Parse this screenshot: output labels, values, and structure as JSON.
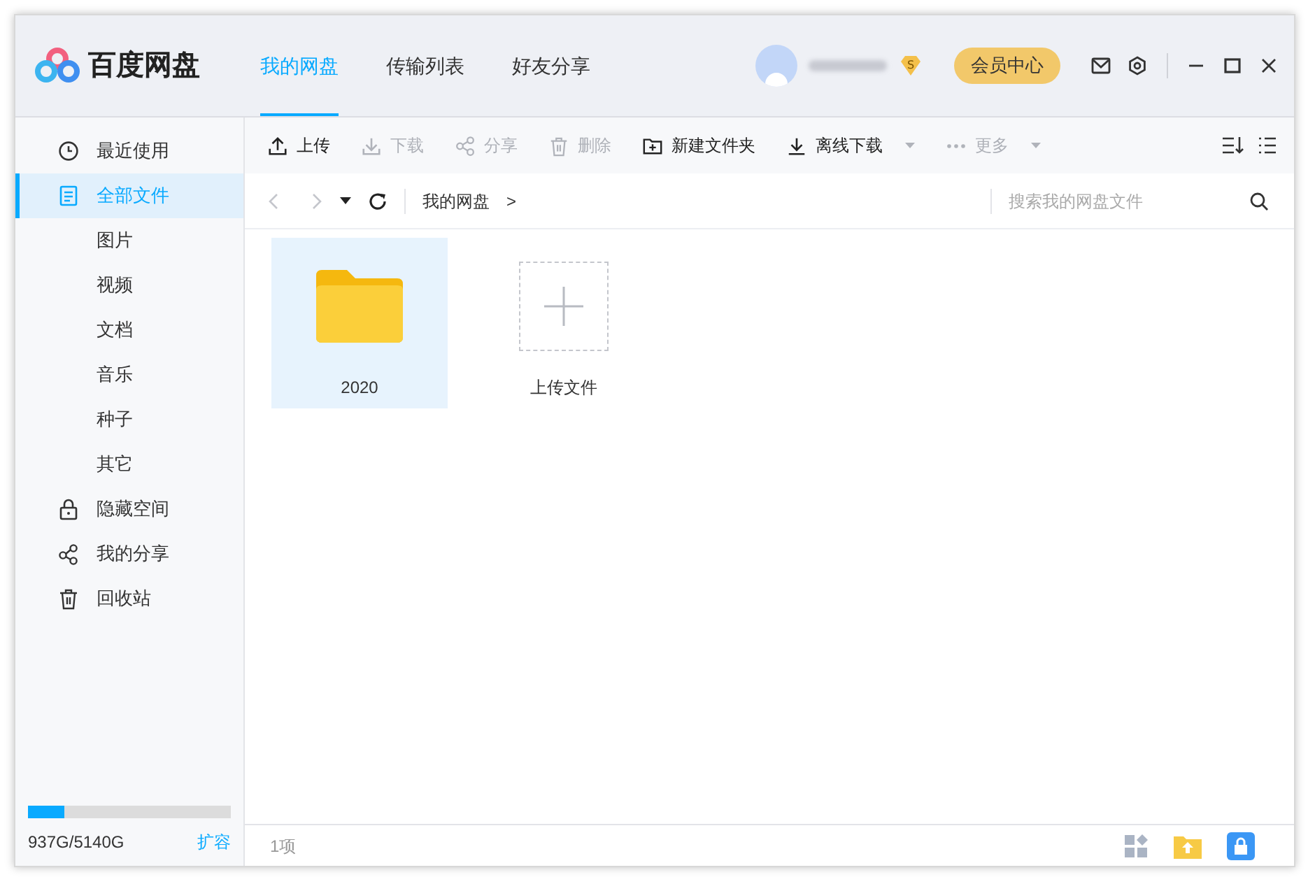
{
  "app": {
    "name": "百度网盘"
  },
  "tabs": [
    {
      "label": "我的网盘",
      "selected": true
    },
    {
      "label": "传输列表",
      "selected": false
    },
    {
      "label": "好友分享",
      "selected": false
    }
  ],
  "account": {
    "vip_badge": "S",
    "vip_button": "会员中心"
  },
  "sidebar": {
    "items": [
      {
        "label": "最近使用",
        "kind": "main",
        "selected": false
      },
      {
        "label": "全部文件",
        "kind": "main",
        "selected": true
      },
      {
        "label": "图片",
        "kind": "sub",
        "selected": false
      },
      {
        "label": "视频",
        "kind": "sub",
        "selected": false
      },
      {
        "label": "文档",
        "kind": "sub",
        "selected": false
      },
      {
        "label": "音乐",
        "kind": "sub",
        "selected": false
      },
      {
        "label": "种子",
        "kind": "sub",
        "selected": false
      },
      {
        "label": "其它",
        "kind": "sub",
        "selected": false
      },
      {
        "label": "隐藏空间",
        "kind": "main",
        "selected": false
      },
      {
        "label": "我的分享",
        "kind": "main",
        "selected": false
      },
      {
        "label": "回收站",
        "kind": "main",
        "selected": false
      }
    ],
    "storage": {
      "level": 0.18,
      "reading": "937G/5140G",
      "expand_link": "扩容"
    }
  },
  "toolbar": [
    {
      "label": "上传",
      "disabled": false,
      "dropdown": false
    },
    {
      "label": "下载",
      "disabled": true,
      "dropdown": false
    },
    {
      "label": "分享",
      "disabled": true,
      "dropdown": false
    },
    {
      "label": "删除",
      "disabled": true,
      "dropdown": false
    },
    {
      "label": "新建文件夹",
      "disabled": false,
      "dropdown": false
    },
    {
      "label": "离线下载",
      "disabled": false,
      "dropdown": true
    },
    {
      "label": "更多",
      "disabled": true,
      "dropdown": true
    }
  ],
  "breadcrumb": {
    "path": "我的网盘",
    "separator": ">"
  },
  "search": {
    "placeholder": "搜索我的网盘文件"
  },
  "files": [
    {
      "kind": "folder",
      "name": "2020",
      "selected": true
    },
    {
      "kind": "upload",
      "name": "上传文件",
      "selected": false
    }
  ],
  "status_bar": {
    "count": "1项"
  }
}
